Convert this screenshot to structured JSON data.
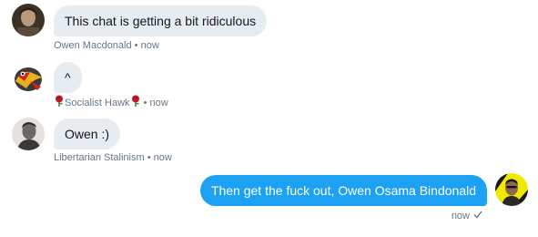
{
  "messages": [
    {
      "text": "This chat is getting a bit ridiculous",
      "sender": "Owen Macdonald",
      "time": "now",
      "avatar": "avatar-owen-macdonald-portrait"
    },
    {
      "text": "^",
      "sender": "Socialist Hawk",
      "time": "now",
      "avatar": "avatar-hawk-cartoon"
    },
    {
      "text": "Owen :)",
      "sender": "Libertarian Stalinism",
      "time": "now",
      "avatar": "avatar-bw-portrait"
    },
    {
      "text": "Then get the fuck out, Owen Osama Bindonald",
      "time": "now",
      "status_icon": "read-check-icon",
      "avatar": "avatar-self-yellow"
    }
  ],
  "separator": "•",
  "colors": {
    "incoming_bubble": "#e6ecf0",
    "outgoing_bubble": "#1da1f2",
    "meta_text": "#657786",
    "rose": "#c0182b"
  }
}
